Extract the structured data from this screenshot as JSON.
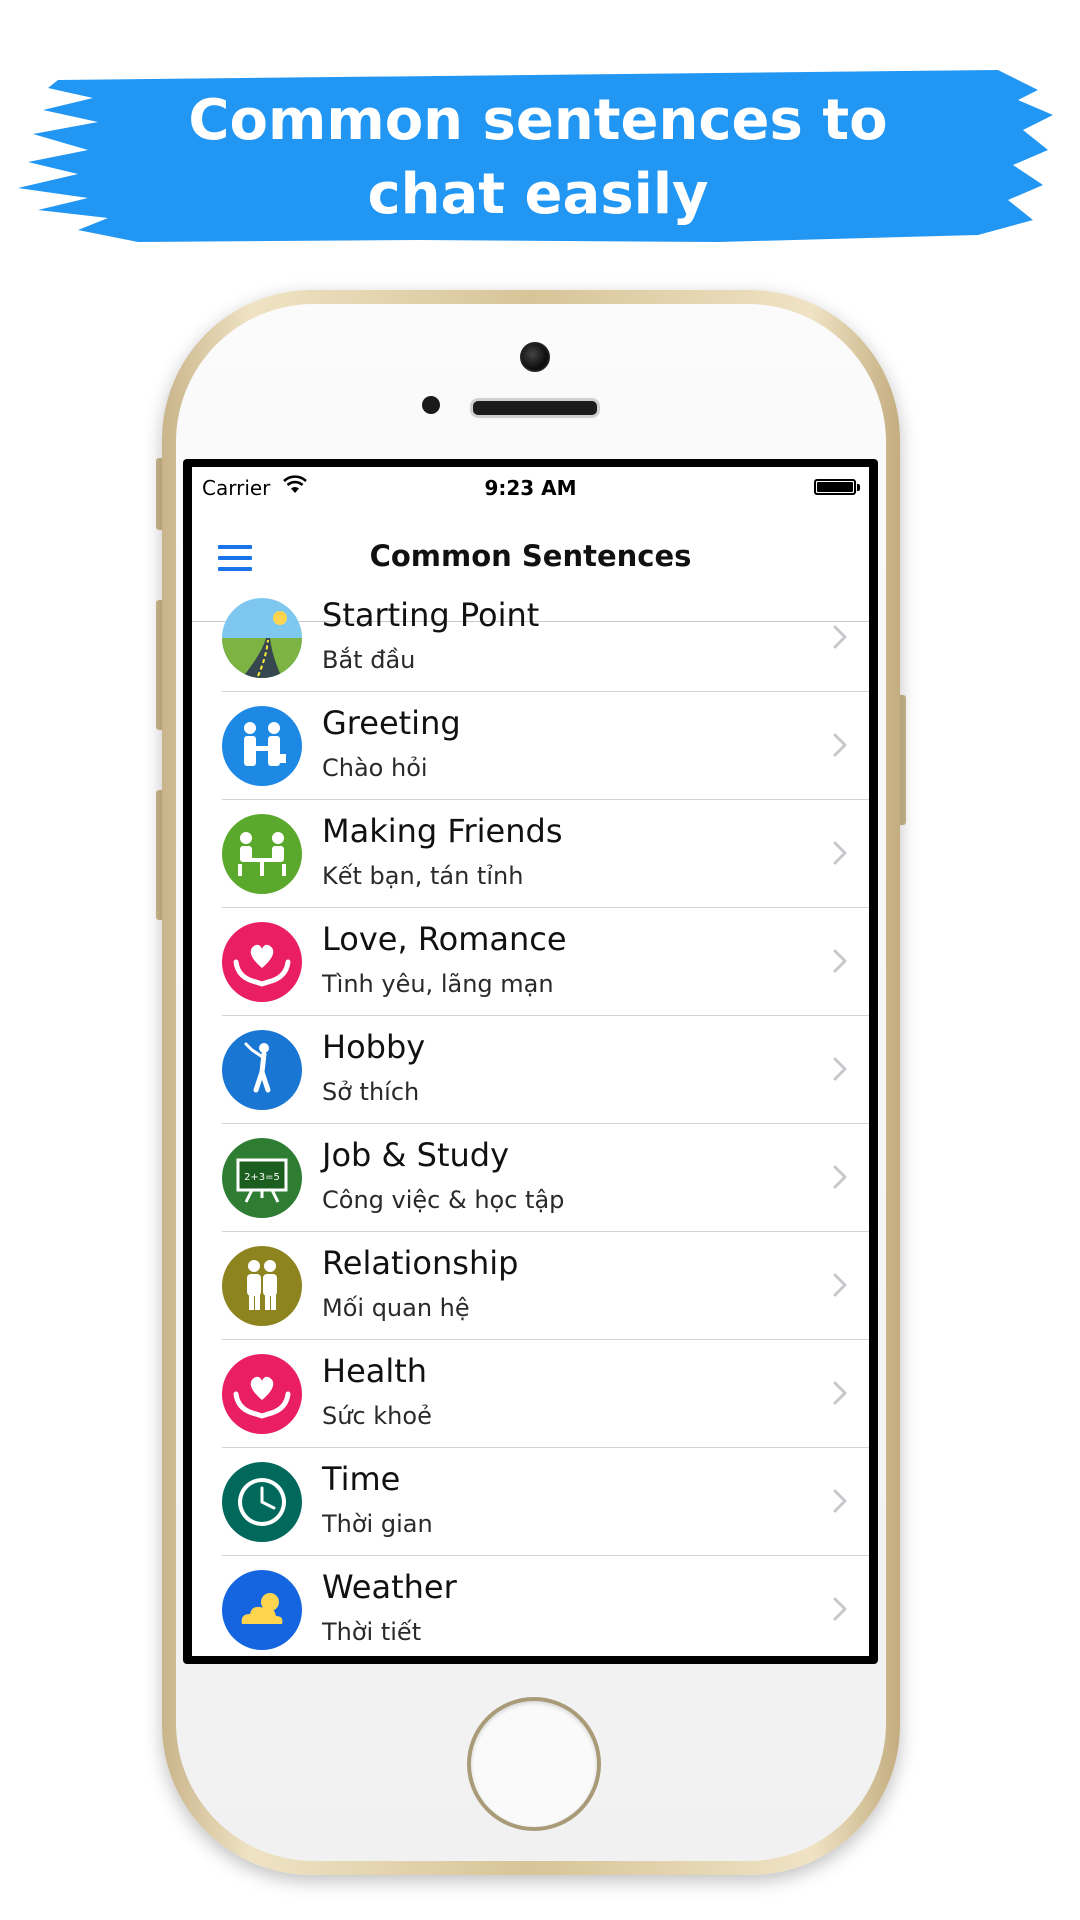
{
  "banner": {
    "line1": "Common sentences to",
    "line2": "chat easily",
    "color": "#2196F3"
  },
  "status_bar": {
    "carrier": "Carrier",
    "time": "9:23 AM",
    "wifi_icon": "wifi-icon",
    "battery_icon": "battery-icon"
  },
  "nav": {
    "title": "Common Sentences",
    "menu_icon": "menu-icon"
  },
  "list": {
    "items": [
      {
        "title": "Starting Point",
        "subtitle": "Bắt đầu",
        "icon": "road-icon",
        "color": "#7ec8f0"
      },
      {
        "title": "Greeting",
        "subtitle": "Chào hỏi",
        "icon": "handshake-icon",
        "color": "#1e88e5"
      },
      {
        "title": "Making Friends",
        "subtitle": "Kết bạn, tán tỉnh",
        "icon": "friends-table-icon",
        "color": "#5aa92c"
      },
      {
        "title": "Love, Romance",
        "subtitle": "Tình yêu, lãng mạn",
        "icon": "heart-hands-icon",
        "color": "#e91e63"
      },
      {
        "title": "Hobby",
        "subtitle": "Sở thích",
        "icon": "golfer-icon",
        "color": "#1976d2"
      },
      {
        "title": "Job & Study",
        "subtitle": "Công việc & học tập",
        "icon": "blackboard-icon",
        "color": "#2e7d32"
      },
      {
        "title": "Relationship",
        "subtitle": "Mối quan hệ",
        "icon": "couple-icon",
        "color": "#8d8420"
      },
      {
        "title": "Health",
        "subtitle": "Sức khoẻ",
        "icon": "heart-hands-icon",
        "color": "#e91e63"
      },
      {
        "title": "Time",
        "subtitle": "Thời gian",
        "icon": "clock-icon",
        "color": "#00695c"
      },
      {
        "title": "Weather",
        "subtitle": "Thời tiết",
        "icon": "weather-icon",
        "color": "#1565e0"
      }
    ]
  }
}
